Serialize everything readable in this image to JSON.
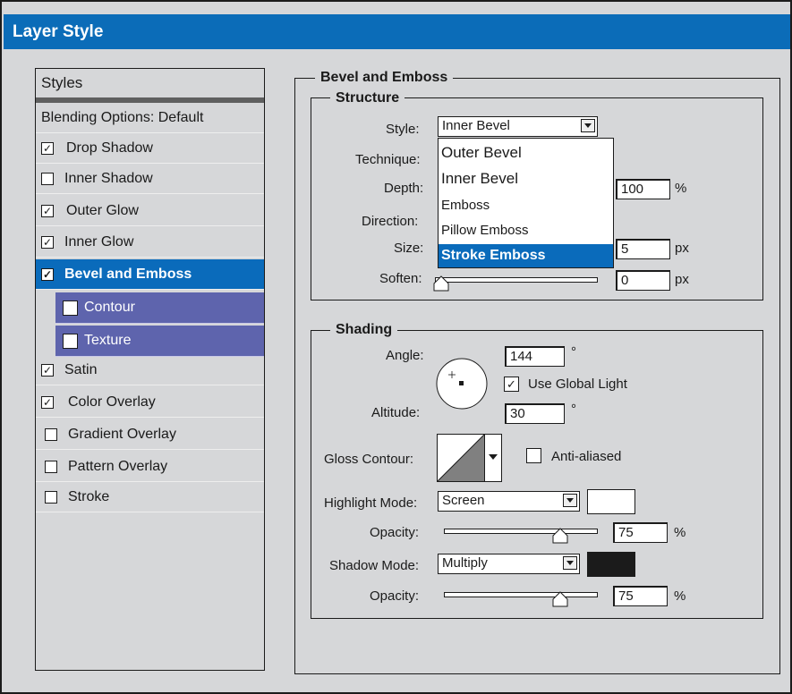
{
  "window": {
    "title": "Layer Style"
  },
  "styles": {
    "header": "Styles",
    "blending": "Blending Options: Default",
    "items": [
      {
        "label": "Drop Shadow",
        "checked": true
      },
      {
        "label": "Inner Shadow",
        "checked": false
      },
      {
        "label": "Outer Glow",
        "checked": true
      },
      {
        "label": "Inner Glow",
        "checked": true
      },
      {
        "label": "Bevel and Emboss",
        "checked": true,
        "selected": true
      },
      {
        "label": "Contour",
        "checked": false,
        "sub": true
      },
      {
        "label": "Texture",
        "checked": false,
        "sub": true
      },
      {
        "label": "Satin",
        "checked": true
      },
      {
        "label": "Color Overlay",
        "checked": true
      },
      {
        "label": "Gradient Overlay",
        "checked": false
      },
      {
        "label": "Pattern Overlay",
        "checked": false
      },
      {
        "label": "Stroke",
        "checked": false
      }
    ]
  },
  "bevel": {
    "title": "Bevel and Emboss",
    "structure": {
      "title": "Structure",
      "style_label": "Style:",
      "style_value": "Inner Bevel",
      "technique_label": "Technique:",
      "depth_label": "Depth:",
      "depth_value": "100",
      "depth_unit": "%",
      "direction_label": "Direction:",
      "size_label": "Size:",
      "size_value": "5",
      "size_unit": "px",
      "soften_label": "Soften:",
      "soften_value": "0",
      "soften_unit": "px",
      "style_options": [
        "Outer Bevel",
        "Inner Bevel",
        "Emboss",
        "Pillow Emboss",
        "Stroke Emboss"
      ],
      "style_highlighted": "Stroke Emboss"
    },
    "shading": {
      "title": "Shading",
      "angle_label": "Angle:",
      "angle_value": "144",
      "degree": "°",
      "global_light_label": "Use Global Light",
      "global_light_checked": true,
      "altitude_label": "Altitude:",
      "altitude_value": "30",
      "gloss_label": "Gloss Contour:",
      "anti_aliased_label": "Anti-aliased",
      "anti_aliased_checked": false,
      "highlight_mode_label": "Highlight Mode:",
      "highlight_mode_value": "Screen",
      "highlight_color": "#ffffff",
      "highlight_opacity_label": "Opacity:",
      "highlight_opacity_value": "75",
      "opacity_unit": "%",
      "shadow_mode_label": "Shadow Mode:",
      "shadow_mode_value": "Multiply",
      "shadow_color": "#1b1b1b",
      "shadow_opacity_label": "Opacity:",
      "shadow_opacity_value": "75",
      "opacity_level": 0.75
    }
  },
  "colors": {
    "title_bar": "#0b6cb8",
    "selection": "#0a6bbb",
    "sub_item": "#5e64ad",
    "panel": "#d6d7d9"
  }
}
